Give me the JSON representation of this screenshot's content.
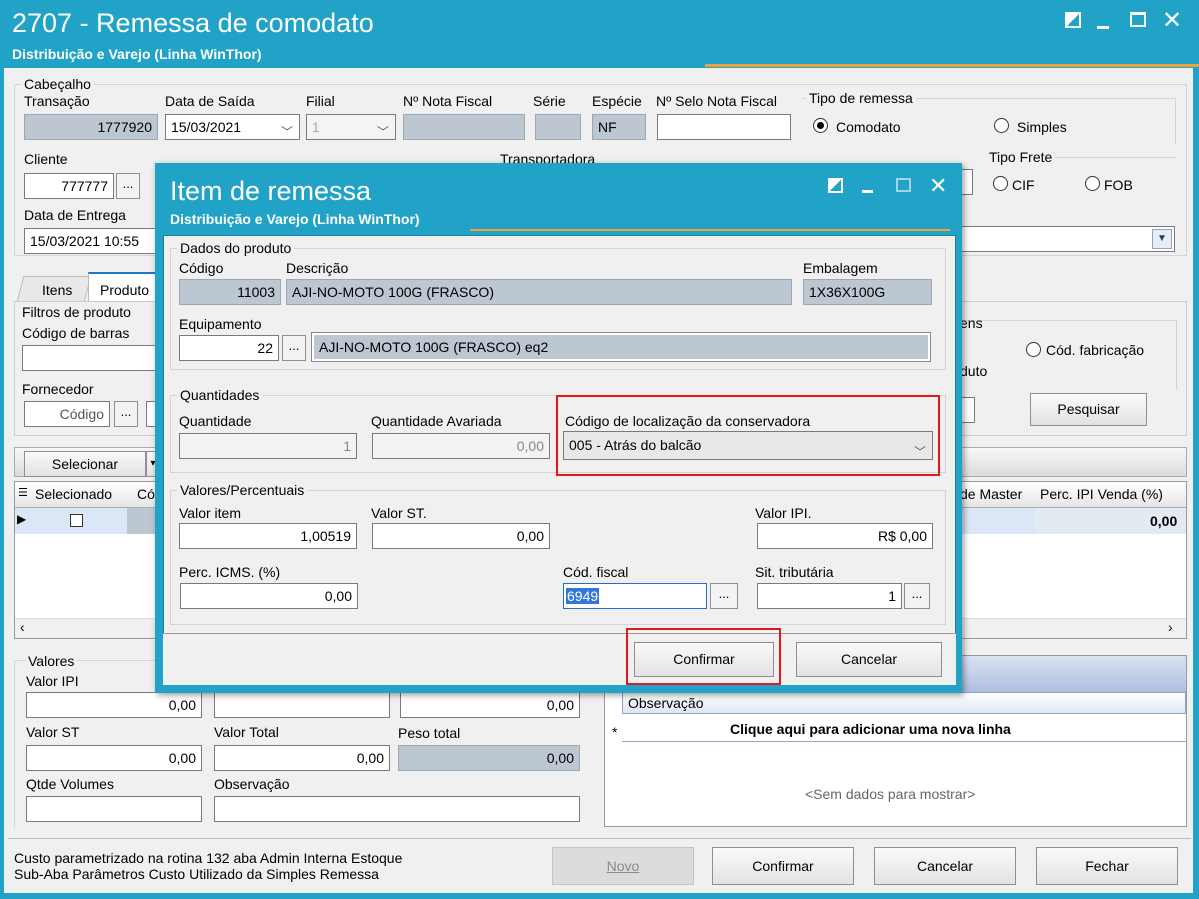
{
  "main": {
    "title": "2707 - Remessa de comodato",
    "subtitle": "Distribuição e Varejo (Linha WinThor)",
    "header": {
      "group": "Cabeçalho",
      "transacao_label": "Transação",
      "transacao": "1777920",
      "data_saida_label": "Data de Saída",
      "data_saida": "15/03/2021",
      "filial_label": "Filial",
      "filial": "1",
      "nota_label": "Nº Nota Fiscal",
      "serie_label": "Série",
      "especie_label": "Espécie",
      "especie": "NF",
      "selo_label": "Nº Selo Nota Fiscal",
      "tipo_remessa_label": "Tipo de remessa",
      "comodato": "Comodato",
      "simples": "Simples",
      "cliente_label": "Cliente",
      "cliente": "777777",
      "transportadora_label": "Transportadora",
      "tipo_frete_label": "Tipo Frete",
      "cif": "CIF",
      "fob": "FOB",
      "data_entrega_label": "Data de Entrega",
      "data_entrega": "15/03/2021 10:55"
    },
    "tabs": {
      "itens": "Itens",
      "produtos": "Produto"
    },
    "filters": {
      "title": "Filtros de produto",
      "codigo_barras": "Código de barras",
      "fornecedor": "Fornecedor",
      "codigo_placeholder": "Código",
      "partial": "ens",
      "cod_fab": "Cód. fabricação",
      "duto": "duto",
      "pesquisar": "Pesquisar"
    },
    "selecionar": "Selecionar",
    "grid": {
      "col_selecionado": "Selecionado",
      "col_co": "Có",
      "col_master": "de Master",
      "col_ipi": "Perc. IPI Venda (%)",
      "row_ipi": "0,00"
    },
    "valores": {
      "group": "Valores",
      "valor_ipi_label": "Valor IPI",
      "valor_ipi": "0,00",
      "mid_val": "0,00",
      "valor_st_label": "Valor ST",
      "valor_st": "0,00",
      "valor_total_label": "Valor Total",
      "valor_total": "0,00",
      "peso_label": "Peso total",
      "peso": "0,00",
      "qtde_label": "Qtde Volumes",
      "obs_label": "Observação"
    },
    "obs_grid": {
      "header": "Observação",
      "add": "Clique aqui para adicionar uma nova linha",
      "empty": "<Sem dados para mostrar>",
      "star": "*"
    },
    "footer": {
      "note1": "Custo parametrizado na rotina 132 aba Admin Interna  Estoque",
      "note2": "Sub-Aba Parâmetros Custo Utilizado da Simples Remessa",
      "novo": "Novo",
      "confirmar": "Confirmar",
      "cancelar": "Cancelar",
      "fechar": "Fechar"
    }
  },
  "dialog": {
    "title": "Item de remessa",
    "subtitle": "Distribuição e Varejo (Linha WinThor)",
    "produto": {
      "group": "Dados do produto",
      "codigo_label": "Código",
      "codigo": "11003",
      "descricao_label": "Descrição",
      "descricao": "AJI-NO-MOTO 100G (FRASCO)",
      "embalagem_label": "Embalagem",
      "embalagem": "1X36X100G",
      "equip_label": "Equipamento",
      "equip_code": "22",
      "equip_desc": "AJI-NO-MOTO 100G (FRASCO) eq2"
    },
    "quant": {
      "group": "Quantidades",
      "qtd_label": "Quantidade",
      "qtd": "1",
      "avariada_label": "Quantidade Avariada",
      "avariada": "0,00",
      "loc_label": "Código de localização da conservadora",
      "loc": "005 - Atrás do balcão"
    },
    "valores": {
      "group": "Valores/Percentuais",
      "item_label": "Valor item",
      "item": "1,00519",
      "st_label": "Valor ST.",
      "st": "0,00",
      "ipi_label": "Valor IPI.",
      "ipi": "R$ 0,00",
      "icms_label": "Perc. ICMS. (%)",
      "icms": "0,00",
      "fiscal_label": "Cód. fiscal",
      "fiscal": "6949",
      "sit_label": "Sit. tributária",
      "sit": "1"
    },
    "confirmar": "Confirmar",
    "cancelar": "Cancelar"
  },
  "ellipsis": "..."
}
